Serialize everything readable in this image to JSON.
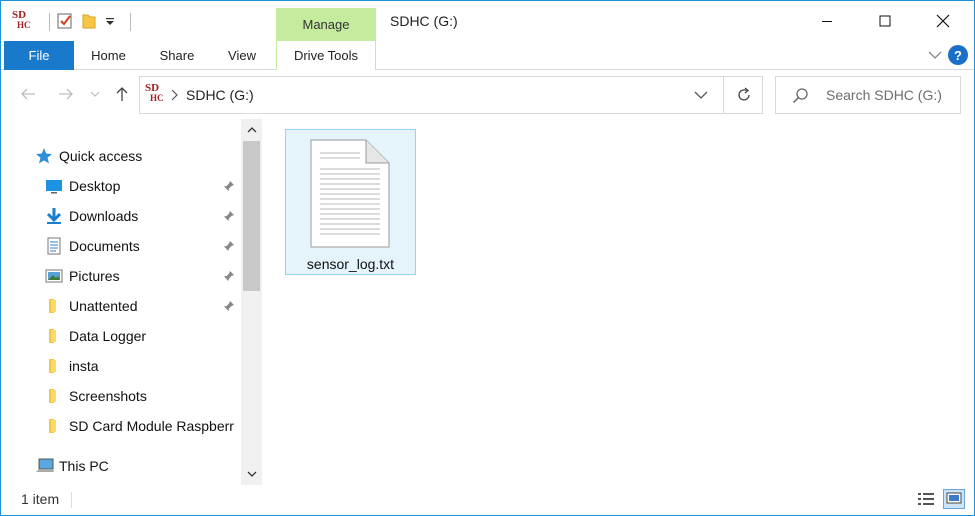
{
  "window": {
    "title": "SDHC (G:)"
  },
  "quick_access_toolbar": {
    "icons": [
      "sd-card-app-icon",
      "properties-icon",
      "new-folder-icon",
      "customize-dropdown-icon"
    ],
    "app_icon_text_top": "SD",
    "app_icon_text_bottom": "HC"
  },
  "ribbon": {
    "context_group": "Manage",
    "tabs": [
      {
        "label": "File"
      },
      {
        "label": "Home"
      },
      {
        "label": "Share"
      },
      {
        "label": "View"
      },
      {
        "label": "Drive Tools"
      }
    ]
  },
  "address_bar": {
    "breadcrumb": "SDHC (G:)"
  },
  "search": {
    "placeholder": "Search SDHC (G:)"
  },
  "nav_pane": {
    "quick_access_label": "Quick access",
    "items": [
      {
        "label": "Desktop",
        "icon": "desktop-icon",
        "pinned": true
      },
      {
        "label": "Downloads",
        "icon": "downloads-icon",
        "pinned": true
      },
      {
        "label": "Documents",
        "icon": "documents-icon",
        "pinned": true
      },
      {
        "label": "Pictures",
        "icon": "pictures-icon",
        "pinned": true
      },
      {
        "label": "Unattented",
        "icon": "folder-icon",
        "pinned": true
      },
      {
        "label": "Data Logger",
        "icon": "folder-icon",
        "pinned": false
      },
      {
        "label": "insta",
        "icon": "folder-icon",
        "pinned": false
      },
      {
        "label": "Screenshots",
        "icon": "folder-icon",
        "pinned": false
      },
      {
        "label": "SD Card Module Raspberr",
        "icon": "folder-icon",
        "pinned": false
      }
    ],
    "this_pc_label": "This PC"
  },
  "files": [
    {
      "name": "sensor_log.txt",
      "icon": "text-document-icon",
      "selected": true
    }
  ],
  "status_bar": {
    "item_count": "1 item"
  },
  "colors": {
    "accent": "#1979ca",
    "context_tab": "#c5ec9e",
    "selection_bg": "#e5f3fb",
    "selection_border": "#99d1f3",
    "window_border": "#1e90d8"
  }
}
